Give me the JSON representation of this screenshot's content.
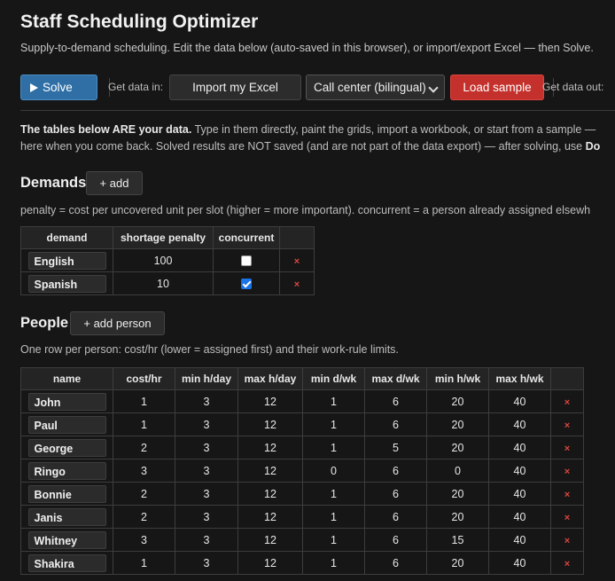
{
  "header": {
    "title": "Staff Scheduling Optimizer",
    "subtitle": "Supply-to-demand scheduling. Edit the data below (auto-saved in this browser), or import/export Excel — then Solve."
  },
  "toolbar": {
    "solve_label": "Solve",
    "get_data_in_label": "Get data in:",
    "import_label": "Import my Excel",
    "sample_select_value": "Call center (bilingual)",
    "load_sample_label": "Load sample",
    "get_data_out_label": "Get data out:"
  },
  "note": {
    "line1_bold": "The tables below ARE your data.",
    "line1_rest": " Type in them directly, paint the grids, import a workbook, or start from a sample —",
    "line2_text": "here when you come back. Solved results are NOT saved (and are not part of the data export) — after solving, use ",
    "line2_bold": "Do"
  },
  "demands": {
    "heading": "Demands",
    "add_label": "+ add",
    "description": "penalty = cost per uncovered unit per slot (higher = more important). concurrent = a person already assigned elsewh",
    "columns": [
      "demand",
      "shortage penalty",
      "concurrent"
    ],
    "rows": [
      {
        "name": "English",
        "penalty": "100",
        "concurrent": false
      },
      {
        "name": "Spanish",
        "penalty": "10",
        "concurrent": true
      }
    ],
    "remove_glyph": "×"
  },
  "people": {
    "heading": "People",
    "add_label": "+ add person",
    "description": "One row per person: cost/hr (lower = assigned first) and their work-rule limits.",
    "columns": [
      "name",
      "cost/hr",
      "min h/day",
      "max h/day",
      "min d/wk",
      "max d/wk",
      "min h/wk",
      "max h/wk"
    ],
    "rows": [
      {
        "name": "John",
        "cost": "1",
        "min_hday": "3",
        "max_hday": "12",
        "min_dwk": "1",
        "max_dwk": "6",
        "min_hwk": "20",
        "max_hwk": "40"
      },
      {
        "name": "Paul",
        "cost": "1",
        "min_hday": "3",
        "max_hday": "12",
        "min_dwk": "1",
        "max_dwk": "6",
        "min_hwk": "20",
        "max_hwk": "40"
      },
      {
        "name": "George",
        "cost": "2",
        "min_hday": "3",
        "max_hday": "12",
        "min_dwk": "1",
        "max_dwk": "5",
        "min_hwk": "20",
        "max_hwk": "40"
      },
      {
        "name": "Ringo",
        "cost": "3",
        "min_hday": "3",
        "max_hday": "12",
        "min_dwk": "0",
        "max_dwk": "6",
        "min_hwk": "0",
        "max_hwk": "40"
      },
      {
        "name": "Bonnie",
        "cost": "2",
        "min_hday": "3",
        "max_hday": "12",
        "min_dwk": "1",
        "max_dwk": "6",
        "min_hwk": "20",
        "max_hwk": "40"
      },
      {
        "name": "Janis",
        "cost": "2",
        "min_hday": "3",
        "max_hday": "12",
        "min_dwk": "1",
        "max_dwk": "6",
        "min_hwk": "20",
        "max_hwk": "40"
      },
      {
        "name": "Whitney",
        "cost": "3",
        "min_hday": "3",
        "max_hday": "12",
        "min_dwk": "1",
        "max_dwk": "6",
        "min_hwk": "15",
        "max_hwk": "40"
      },
      {
        "name": "Shakira",
        "cost": "1",
        "min_hday": "3",
        "max_hday": "12",
        "min_dwk": "1",
        "max_dwk": "6",
        "min_hwk": "20",
        "max_hwk": "40"
      }
    ],
    "remove_glyph": "×"
  }
}
